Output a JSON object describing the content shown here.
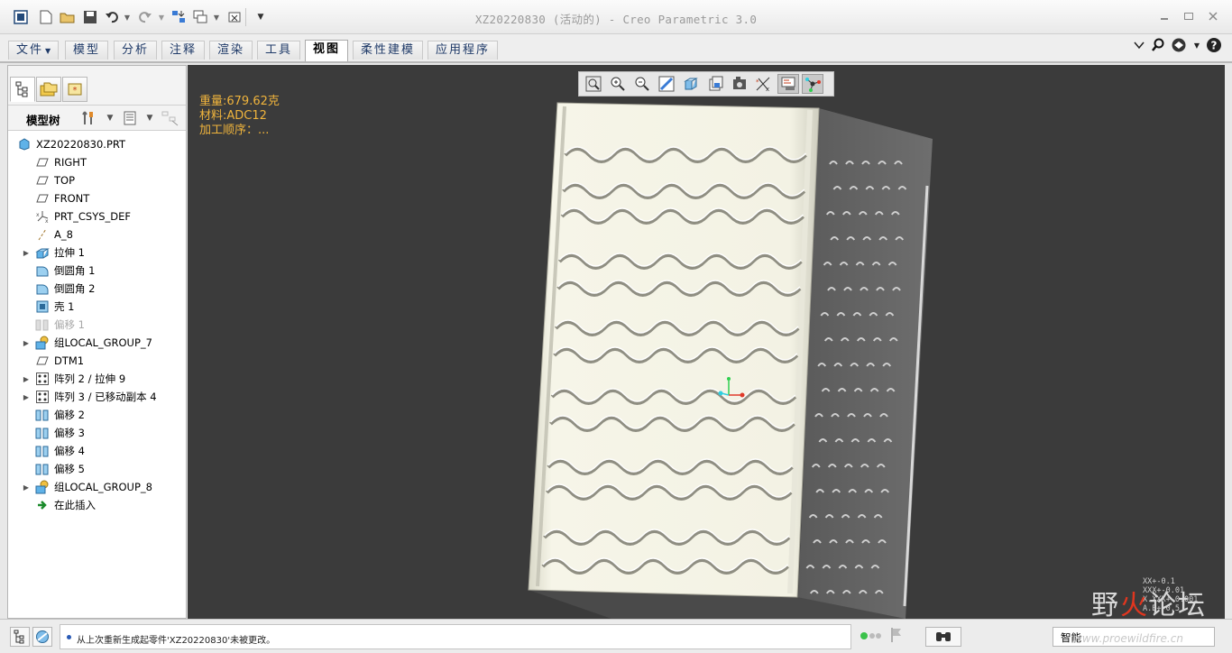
{
  "window": {
    "title": "XZ20220830 (活动的) - Creo Parametric 3.0",
    "quick_access": [
      "app-icon",
      "new-icon",
      "open-icon",
      "save-icon",
      "undo-icon",
      "redo-icon",
      "regenerate-icon",
      "windows-icon",
      "close-window-icon",
      "customize-icon"
    ]
  },
  "ribbon": {
    "tabs": [
      {
        "label": "文件",
        "has_menu": true
      },
      {
        "label": "模型"
      },
      {
        "label": "分析"
      },
      {
        "label": "注释"
      },
      {
        "label": "渲染"
      },
      {
        "label": "工具"
      },
      {
        "label": "视图",
        "active": true
      },
      {
        "label": "柔性建模"
      },
      {
        "label": "应用程序"
      }
    ],
    "right_icons": [
      "minimize-ribbon-icon",
      "search-icon",
      "community-icon",
      "help-icon"
    ]
  },
  "left_panel": {
    "tabs": [
      "model-tree-tab",
      "folder-browser-tab",
      "favorites-tab"
    ],
    "toolbar_label": "模型树",
    "tree": [
      {
        "label": "XZ20220830.PRT",
        "icon": "part-icon",
        "level": 0
      },
      {
        "label": "RIGHT",
        "icon": "datum-plane-icon",
        "level": 1
      },
      {
        "label": "TOP",
        "icon": "datum-plane-icon",
        "level": 1
      },
      {
        "label": "FRONT",
        "icon": "datum-plane-icon",
        "level": 1
      },
      {
        "label": "PRT_CSYS_DEF",
        "icon": "csys-icon",
        "level": 1
      },
      {
        "label": "A_8",
        "icon": "axis-icon",
        "level": 1
      },
      {
        "label": "拉伸 1",
        "icon": "extrude-icon",
        "level": 1,
        "expandable": true
      },
      {
        "label": "倒圆角 1",
        "icon": "round-icon",
        "level": 1
      },
      {
        "label": "倒圆角 2",
        "icon": "round-icon",
        "level": 1
      },
      {
        "label": "壳 1",
        "icon": "shell-icon",
        "level": 1
      },
      {
        "label": "偏移 1",
        "icon": "offset-icon",
        "level": 1,
        "dimmed": true
      },
      {
        "label": "组LOCAL_GROUP_7",
        "icon": "group-icon",
        "level": 1,
        "expandable": true
      },
      {
        "label": "DTM1",
        "icon": "datum-plane-icon",
        "level": 1
      },
      {
        "label": "阵列 2 / 拉伸 9",
        "icon": "pattern-icon",
        "level": 1,
        "expandable": true
      },
      {
        "label": "阵列 3 / 已移动副本 4",
        "icon": "pattern-icon",
        "level": 1,
        "expandable": true
      },
      {
        "label": "偏移 2",
        "icon": "offset-icon",
        "level": 1
      },
      {
        "label": "偏移 3",
        "icon": "offset-icon",
        "level": 1
      },
      {
        "label": "偏移 4",
        "icon": "offset-icon",
        "level": 1
      },
      {
        "label": "偏移 5",
        "icon": "offset-icon",
        "level": 1
      },
      {
        "label": "组LOCAL_GROUP_8",
        "icon": "group-icon",
        "level": 1,
        "expandable": true
      },
      {
        "label": "在此插入",
        "icon": "insert-here-icon",
        "level": 1
      }
    ]
  },
  "viewport": {
    "info_lines": [
      "重量:679.62克",
      "材料:ADC12",
      "加工顺序：..."
    ],
    "toolbar": [
      "refit-icon",
      "zoom-in-icon",
      "zoom-out-icon",
      "repaint-icon",
      "display-style-icon",
      "saved-orientations-icon",
      "view-manager-icon",
      "datum-display-icon",
      "annotation-display-icon",
      "spin-center-icon"
    ],
    "toolbar_active": [
      8,
      9
    ],
    "background_color": "#3b3b3b",
    "watermark": {
      "text_a": "野",
      "text_b": "火",
      "text_c": "论坛",
      "url": "www.proewildfire.cn",
      "values": [
        "XX+-0.1",
        "XXX+-0.01",
        "X.XXX+-0.001",
        "A.B+-0.5"
      ]
    }
  },
  "status": {
    "message": "从上次重新生成起零件'XZ20220830'未被更改。",
    "selection_filter": "智能"
  },
  "colors": {
    "accent": "#1f3a68",
    "info_text": "#f0b43c",
    "watermark_red": "#e0361f",
    "model_face": "#f3f2e4",
    "model_side": "#6a6a6a"
  }
}
